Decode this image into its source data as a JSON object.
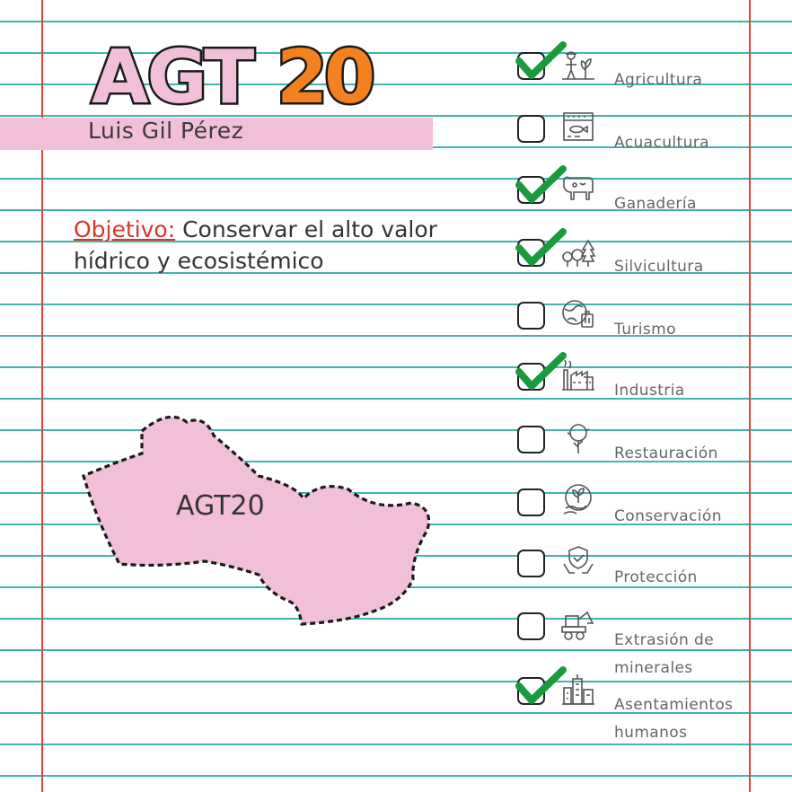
{
  "title": {
    "letters": "AGT",
    "number": "20"
  },
  "author": "Luis Gil Pérez",
  "objective": {
    "label": "Objetivo:",
    "text": "Conservar el alto valor hídrico y ecosistémico"
  },
  "map": {
    "label": "AGT20"
  },
  "colors": {
    "pink": "#f2bfd9",
    "orange": "#f4811f",
    "check_green": "#1a9a3f",
    "line_teal": "#3fb7ae",
    "margin_red": "#e0453a"
  },
  "sectors": [
    {
      "label": "Agricultura",
      "checked": true,
      "icon": "farmer-icon"
    },
    {
      "label": "Acuacultura",
      "checked": false,
      "icon": "fish-tank-icon"
    },
    {
      "label": "Ganadería",
      "checked": true,
      "icon": "cow-icon"
    },
    {
      "label": "Silvicultura",
      "checked": true,
      "icon": "trees-icon"
    },
    {
      "label": "Turismo",
      "checked": false,
      "icon": "globe-luggage-icon"
    },
    {
      "label": "Industria",
      "checked": true,
      "icon": "factory-icon"
    },
    {
      "label": "Restauración",
      "checked": false,
      "icon": "tree-hand-icon"
    },
    {
      "label": "Conservación",
      "checked": false,
      "icon": "plant-hand-icon"
    },
    {
      "label": "Protección",
      "checked": false,
      "icon": "shield-hands-icon"
    },
    {
      "label": "Extrasión de minerales",
      "line1": "Extrasión de",
      "line2": "minerales",
      "checked": false,
      "icon": "excavator-icon"
    },
    {
      "label": "Asentamientos humanos",
      "line1": "Asentamientos",
      "line2": "humanos",
      "checked": true,
      "icon": "city-icon"
    }
  ]
}
